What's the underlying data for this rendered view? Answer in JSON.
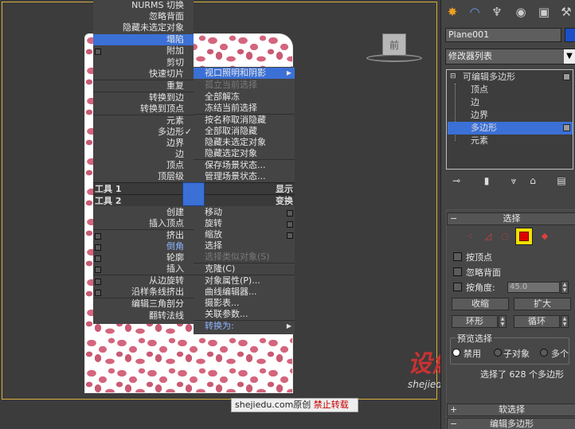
{
  "viewport": {
    "view_label": "前"
  },
  "quad_menu": {
    "top_left": {
      "items": [
        "NURMS 切换",
        "忽略背面",
        "隐藏未选定对象",
        "塌陷",
        "附加",
        "剪切",
        "快速切片",
        "重复",
        "转换到边",
        "转换到顶点",
        "元素",
        "多边形",
        "边界",
        "边",
        "顶点",
        "顶层级"
      ],
      "checked_item": "多边形"
    },
    "top_right": {
      "items": [
        "视口照明和阴影",
        "孤立当前选择",
        "全部解冻",
        "冻结当前选择",
        "按名称取消隐藏",
        "全部取消隐藏",
        "隐藏未选定对象",
        "隐藏选定对象",
        "保存场景状态...",
        "管理场景状态..."
      ]
    },
    "bottom_left": {
      "items": [
        "创建",
        "插入顶点",
        "挤出",
        "倒角",
        "轮廓",
        "插入",
        "从边旋转",
        "沿样条线挤出",
        "编辑三角剖分",
        "翻转法线"
      ]
    },
    "bottom_right": {
      "items": [
        "移动",
        "旋转",
        "缩放",
        "选择",
        "选择类似对象(S)",
        "克隆(C)",
        "对象属性(P)...",
        "曲线编辑器...",
        "摄影表...",
        "关联参数...",
        "转换为:"
      ]
    },
    "titles": {
      "tools1": "工具 1",
      "tools2": "工具 2",
      "display": "显示",
      "transform": "变换"
    }
  },
  "watermark": {
    "site": "shejiedu.com原创",
    "notice": "禁止转载",
    "logo_big": "设解读",
    "logo_small": "shejiedu.com"
  },
  "command_panel": {
    "tabs": [
      "create-icon",
      "modify-icon",
      "hierarchy-icon",
      "motion-icon",
      "display-icon",
      "utilities-icon"
    ],
    "object_name": "Plane001",
    "object_color": "#1a4fc8",
    "modifier_list": "修改器列表",
    "stack": {
      "root": "可编辑多边形",
      "sub": [
        "顶点",
        "边",
        "边界",
        "多边形",
        "元素"
      ],
      "selected": "多边形"
    },
    "selection_rollout": {
      "title": "选择",
      "by_vertex": "按顶点",
      "ignore_backfacing": "忽略背面",
      "by_angle": "按角度:",
      "angle_value": "45.0",
      "shrink": "收缩",
      "grow": "扩大",
      "ring": "环形",
      "loop": "循环",
      "preview_group": "预览选择",
      "preview_off": "禁用",
      "preview_subobject": "子对象",
      "preview_multi": "多个",
      "status": "选择了 628 个多边形"
    },
    "soft_selection": "软选择",
    "edit_polygons": "编辑多边形"
  }
}
